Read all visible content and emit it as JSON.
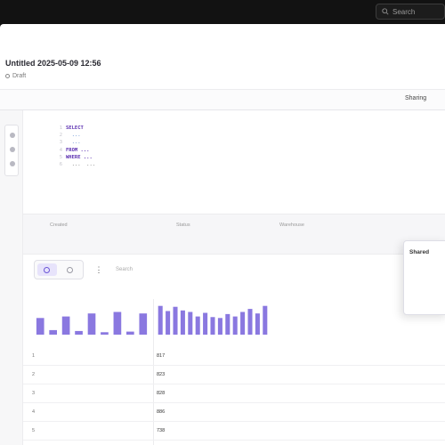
{
  "topbar": {
    "search_placeholder": "Search"
  },
  "header": {
    "title": "Untitled 2025-05-09 12:56",
    "subtitle": "Draft",
    "right_label": "",
    "right_sub": ""
  },
  "toolbar": {
    "action_label": "Sharing"
  },
  "code_lines": [
    "SELECT",
    "  ... ",
    "  ... ",
    "FROM ...",
    "WHERE ...",
    "  ...  ..."
  ],
  "meta": {
    "col1_label": "Created",
    "col1_value": "",
    "col2_label": "Status",
    "col2_value": "",
    "col3_label": "Warehouse",
    "col3_value": "",
    "col4_label": ""
  },
  "popover": {
    "title": "Shared",
    "subtitle": "",
    "link1": "",
    "link2": ""
  },
  "results": {
    "filter_placeholder": "Search",
    "more_label": "⋮",
    "col1_header": "",
    "col2_header": "",
    "col1_type": "",
    "col2_type": "",
    "col1_min": "",
    "col1_max": "",
    "col2_min": "",
    "col2_max": "",
    "col1_bars": [
      0.55,
      0.15,
      0.6,
      0.12,
      0.7,
      0.08,
      0.75,
      0.1,
      0.7
    ],
    "col2_bars": [
      0.95,
      0.78,
      0.92,
      0.8,
      0.75,
      0.6,
      0.72,
      0.58,
      0.55,
      0.68,
      0.6,
      0.75,
      0.85,
      0.7,
      0.95
    ]
  },
  "rows": [
    {
      "index": "1",
      "value": "817"
    },
    {
      "index": "2",
      "value": "823"
    },
    {
      "index": "3",
      "value": "828"
    },
    {
      "index": "4",
      "value": "886"
    },
    {
      "index": "5",
      "value": "738"
    }
  ],
  "colors": {
    "accent": "#6b56d6",
    "bar": "#8a78e0",
    "dark": "#121212"
  }
}
